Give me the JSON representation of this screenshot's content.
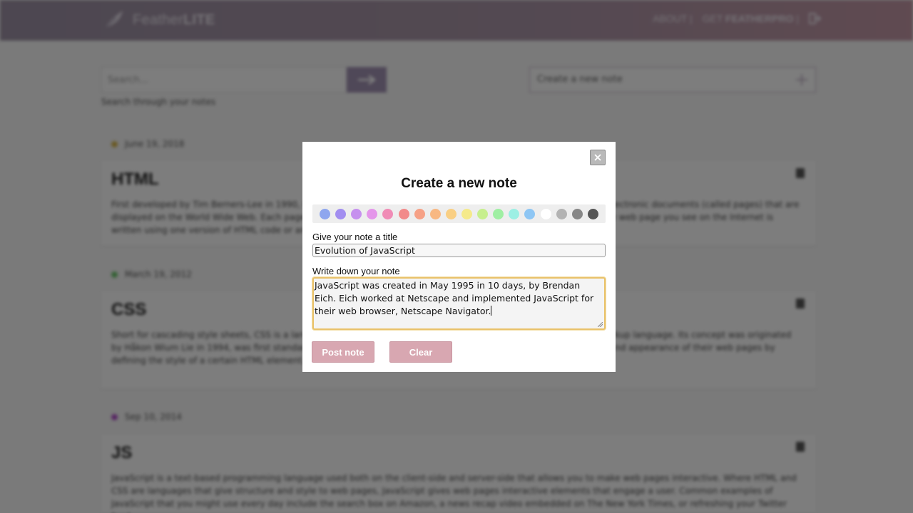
{
  "brand": {
    "name_light": "Feather",
    "name_bold": "LITE"
  },
  "nav": {
    "about": "ABOUT |",
    "get_prefix": "GET ",
    "get_bold": "FEATHERPRO",
    "get_suffix": " |"
  },
  "search": {
    "placeholder": "Search...",
    "hint": "Search through your notes"
  },
  "new_note_bar": {
    "label": "Create a new note"
  },
  "notes": [
    {
      "date": "June 19, 2018",
      "dot_color": "#d4b44a",
      "title": "HTML",
      "body": "First developed by Tim Berners-Lee in 1990, HTML is short for HyperText Markup Language. HTML is used to create electronic documents (called pages) that are displayed on the World Wide Web. Each page contains a series of connections to other pages called hyperlinks. Every web page you see on the Internet is written using one version of HTML code or another."
    },
    {
      "date": "March 19, 2012",
      "dot_color": "#6cc46c",
      "title": "CSS",
      "body": "Short for cascading style sheets, CSS is a language used to describe the presentation of a document written in a markup language. Its concept was originated by Håkon Wium Lie in 1994, was first standardized by the W3C and today allows web developers to alter the layout and appearance of their web pages by defining the style of a certain HTML element, and its size and color."
    },
    {
      "date": "Sep 10, 2014",
      "dot_color": "#b050c8",
      "title": "JS",
      "body": "JavaScript is a text-based programming language used both on the client-side and server-side that allows you to make web pages interactive. Where HTML and CSS are languages that give structure and style to web pages, JavaScript gives web pages interactive elements that engage a user. Common examples of JavaScript that you might use every day include the search box on Amazon, a news recap video embedded on The New York Times, or refreshing your Twitter feed."
    }
  ],
  "modal": {
    "title": "Create a new note",
    "palette": [
      "#8ea6ee",
      "#a28ef0",
      "#c690ee",
      "#e496ea",
      "#f08cb6",
      "#f28a8a",
      "#f6a186",
      "#f8b882",
      "#f9cf84",
      "#f5ea8a",
      "#c7ef8e",
      "#9fefa3",
      "#9cefe4",
      "#8ec6f4",
      "#ffffff",
      "#b3b3b3",
      "#878787",
      "#555555"
    ],
    "title_label": "Give your note a title",
    "title_value": "Evolution of JavaScript",
    "note_label": "Write down your note",
    "note_value": "JavaScript was created in May 1995 in 10 days, by Brendan Eich. Eich worked at Netscape and implemented JavaScript for their web browser, Netscape Navigator.",
    "post_button": "Post note",
    "clear_button": "Clear"
  }
}
